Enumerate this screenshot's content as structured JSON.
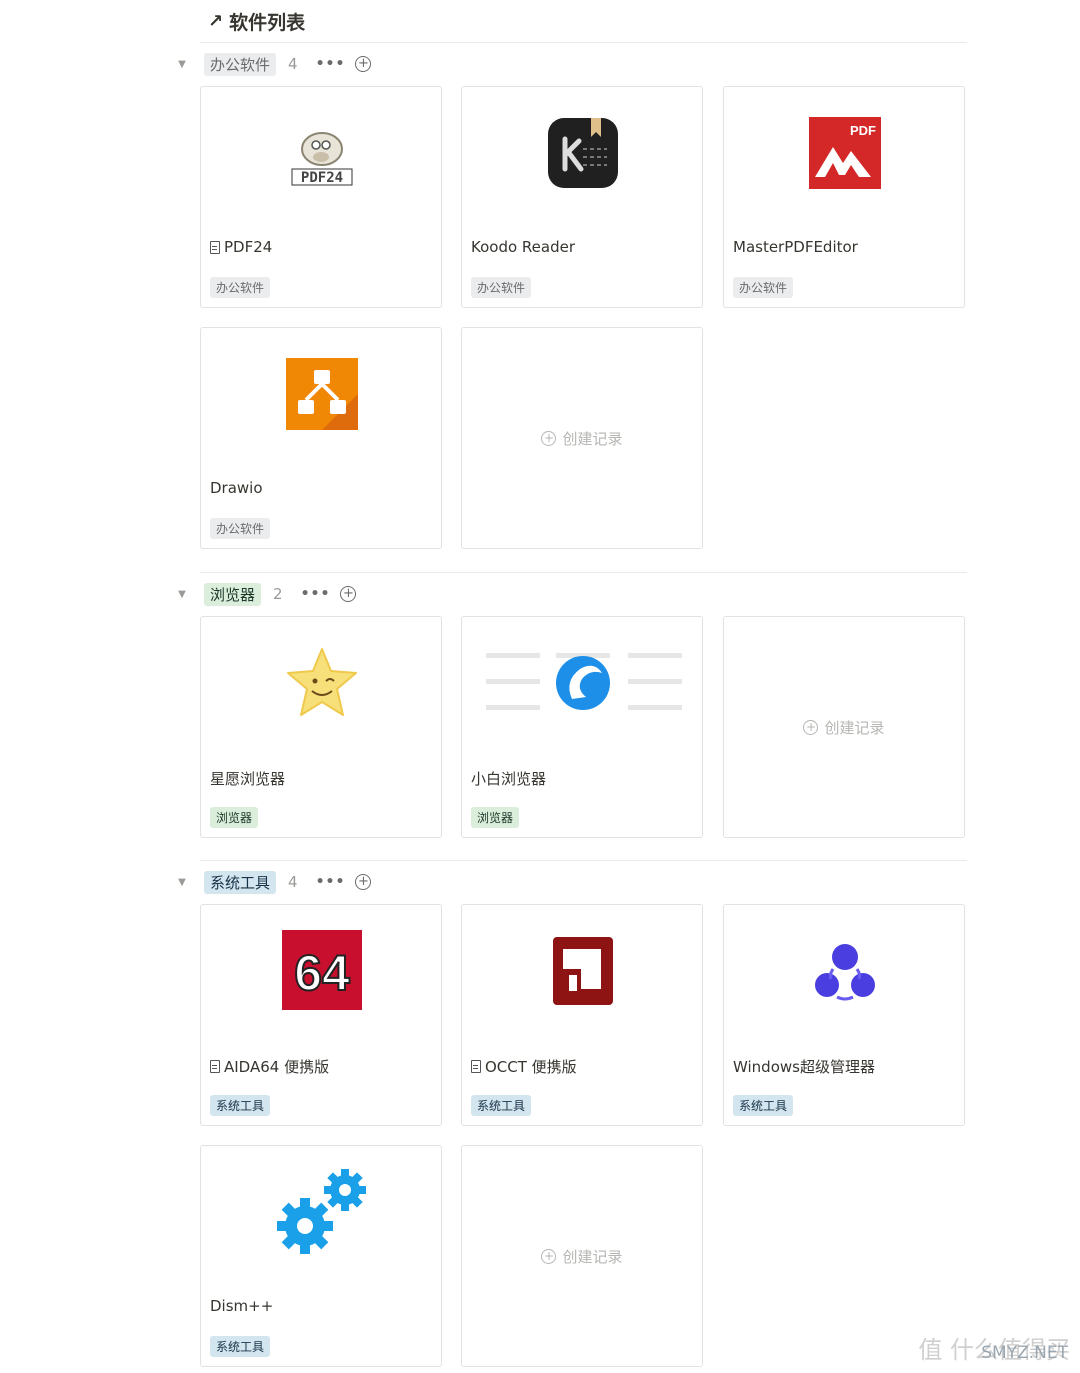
{
  "page": {
    "title": "软件列表",
    "title_icon": "arrow-up-right-icon"
  },
  "groups": [
    {
      "tag": "办公软件",
      "count": "4",
      "color": "gray"
    },
    {
      "tag": "浏览器",
      "count": "2",
      "color": "green"
    },
    {
      "tag": "系统工具",
      "count": "4",
      "color": "blue"
    }
  ],
  "cards": {
    "pdf24": {
      "name": "PDF24",
      "tag": "办公软件",
      "icon_text": "PDF24"
    },
    "koodo": {
      "name": "Koodo Reader",
      "tag": "办公软件"
    },
    "masterpdf": {
      "name": "MasterPDFEditor",
      "tag": "办公软件",
      "icon_text": "PDF"
    },
    "drawio": {
      "name": "Drawio",
      "tag": "办公软件"
    },
    "xingyuan": {
      "name": "星愿浏览器",
      "tag": "浏览器"
    },
    "xiaobai": {
      "name": "小白浏览器",
      "tag": "浏览器"
    },
    "aida64": {
      "name": "AIDA64 便携版",
      "tag": "系统工具",
      "icon_text": "64"
    },
    "occt": {
      "name": "OCCT 便携版",
      "tag": "系统工具"
    },
    "winmgr": {
      "name": "Windows超级管理器",
      "tag": "系统工具"
    },
    "dism": {
      "name": "Dism++",
      "tag": "系统工具"
    }
  },
  "create_label": "创建记录",
  "watermark": {
    "text": "值 什么值得买",
    "site": "SMYZ.NET"
  },
  "colors": {
    "tag_gray": "#ebeced",
    "tag_green": "#dbeddb",
    "tag_blue": "#d3e5ef"
  }
}
